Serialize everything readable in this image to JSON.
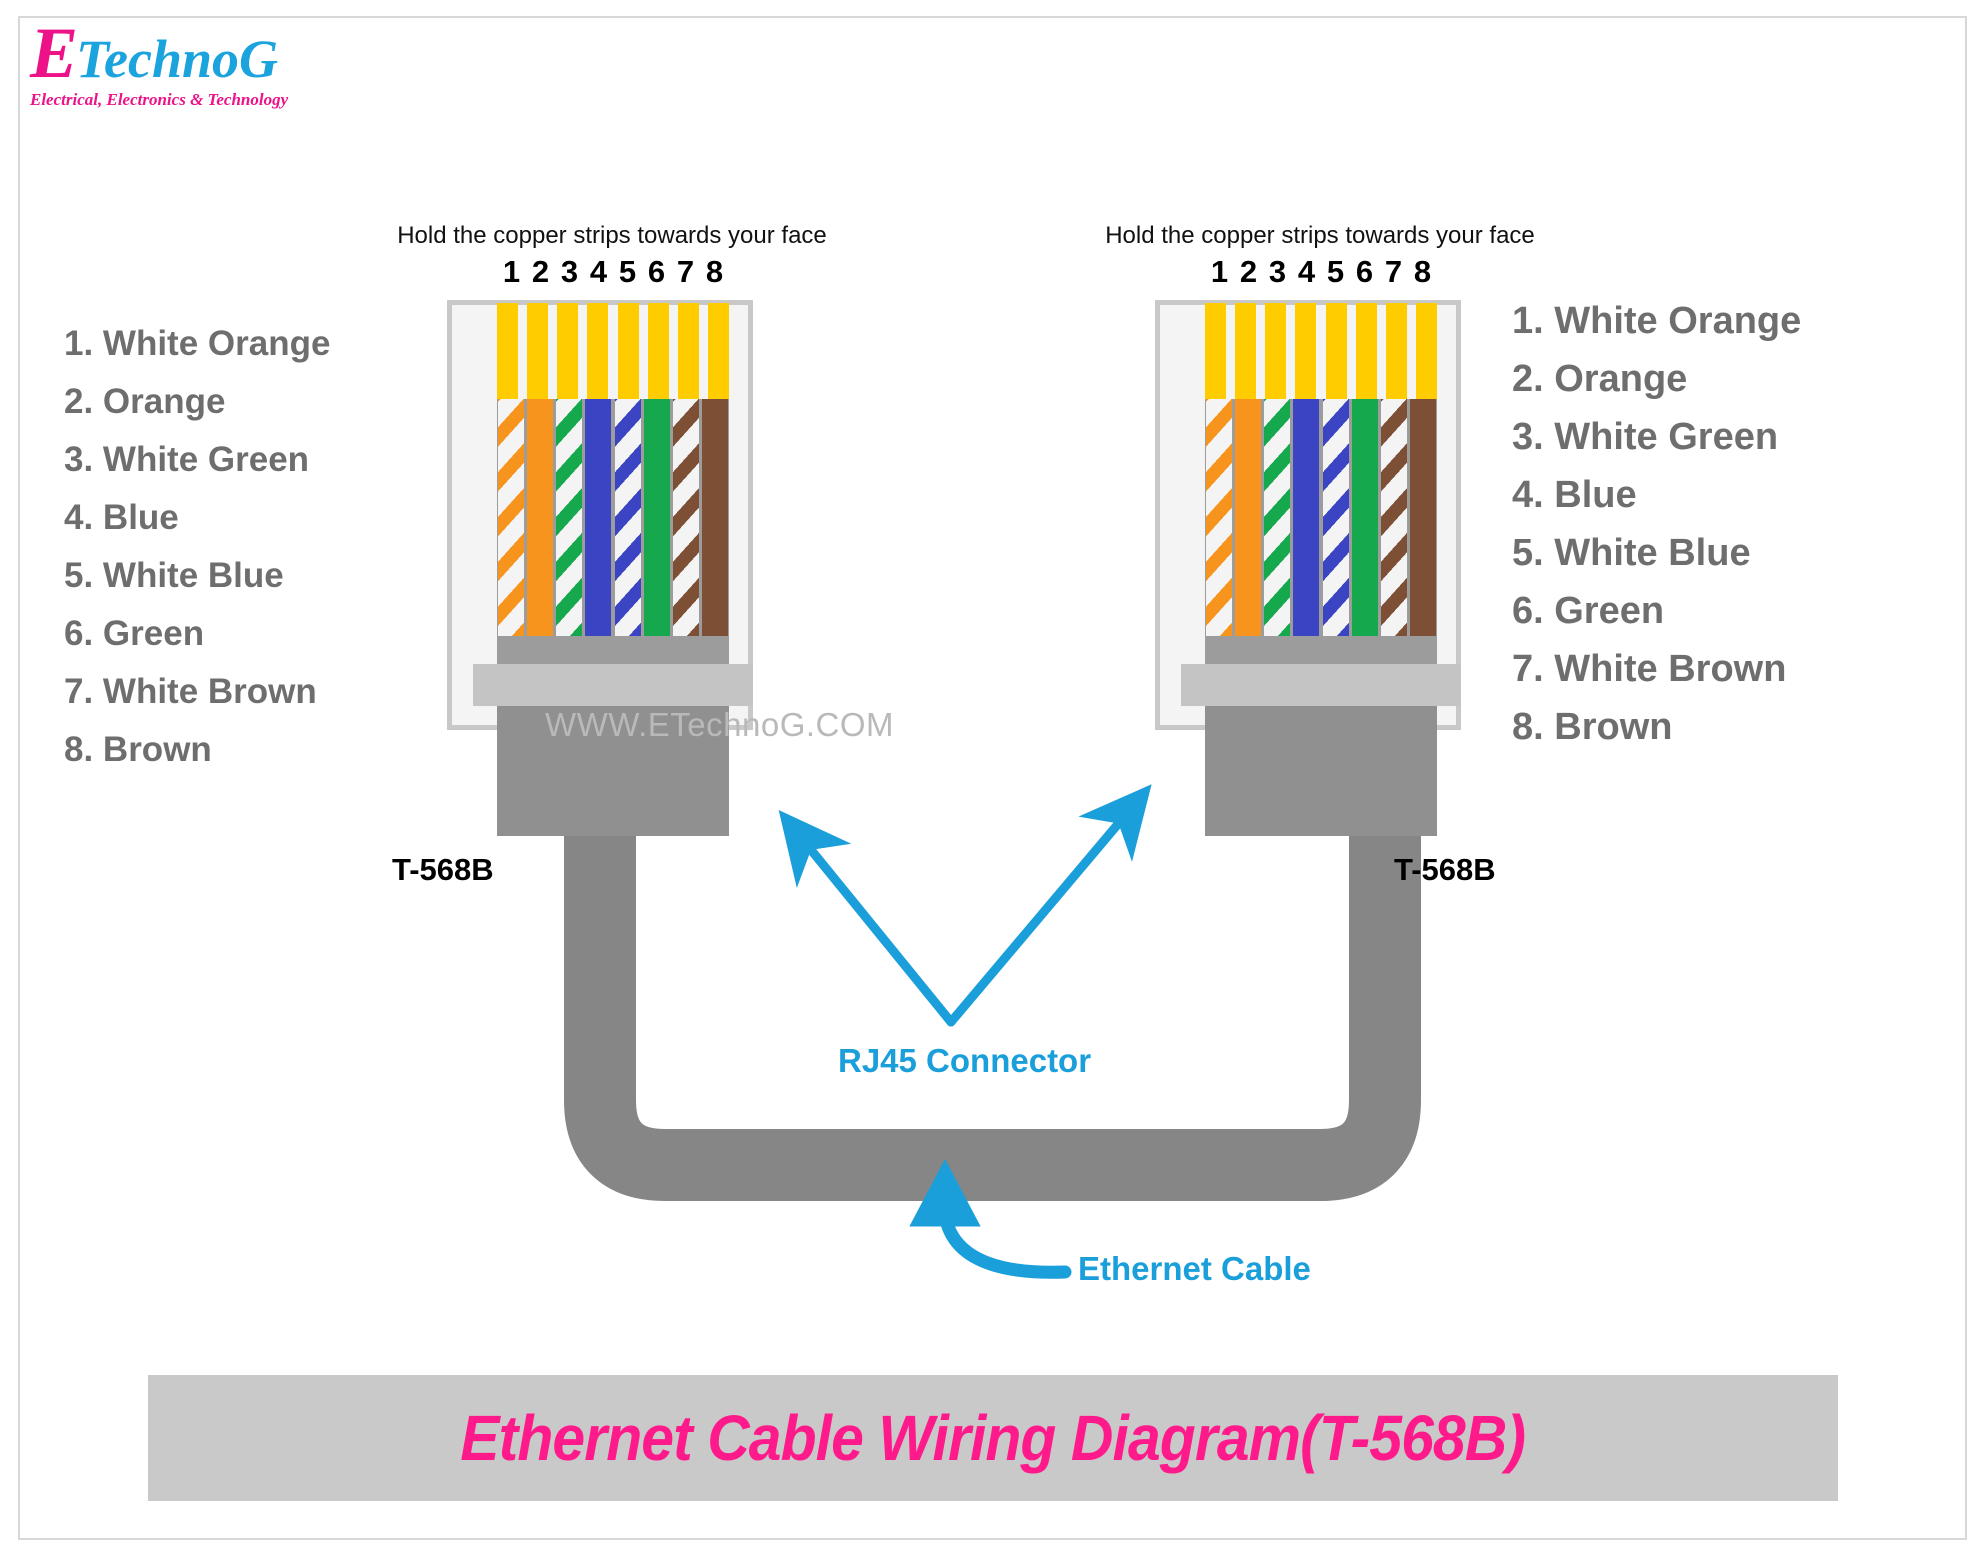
{
  "brand": {
    "logo_initial": "E",
    "logo_rest": "TechnoG",
    "tagline": "Electrical, Electronics & Technology"
  },
  "watermark": "WWW.ETechnoG.COM",
  "title": {
    "text": "Ethernet Cable Wiring Diagram(T-568B)",
    "bar_color": "#c9c9c9",
    "text_color": "#ff1a8c"
  },
  "instruction_text": "Hold the copper strips towards your face",
  "pin_numbers": [
    "1",
    "2",
    "3",
    "4",
    "5",
    "6",
    "7",
    "8"
  ],
  "standard_label": "T-568B",
  "annotations": {
    "rj45": "RJ45 Connector",
    "ethernet_cable": "Ethernet Cable",
    "arrow_color": "#1b9fda"
  },
  "pinout": {
    "standard": "T-568B",
    "pins": [
      {
        "num": "1.",
        "name": "White Orange",
        "color": "#f7941d",
        "style": "striped"
      },
      {
        "num": "2.",
        "name": "Orange",
        "color": "#f7941d",
        "style": "solid"
      },
      {
        "num": "3.",
        "name": "White Green",
        "color": "#15a84c",
        "style": "striped"
      },
      {
        "num": "4.",
        "name": "Blue",
        "color": "#3b45c4",
        "style": "solid"
      },
      {
        "num": "5.",
        "name": "White Blue",
        "color": "#3b45c4",
        "style": "striped"
      },
      {
        "num": "6.",
        "name": "Green",
        "color": "#15a84c",
        "style": "solid"
      },
      {
        "num": "7.",
        "name": "White Brown",
        "color": "#7d5036",
        "style": "striped"
      },
      {
        "num": "8.",
        "name": "Brown",
        "color": "#7d5036",
        "style": "solid"
      }
    ]
  },
  "left_list": {
    "rows": [
      "1. White Orange",
      "2. Orange",
      "3. White Green",
      "4. Blue",
      "5. White Blue",
      "6. Green",
      "7. White Brown",
      "8. Brown"
    ]
  },
  "right_list": {
    "rows": [
      "1. White Orange",
      "2. Orange",
      "3. White Green",
      "4. Blue",
      "5. White Blue",
      "6. Green",
      "7. White Brown",
      "8. Brown"
    ]
  },
  "colors": {
    "contact_gold": "#ffcc00",
    "cable_gray": "#868686",
    "plug_body_gray": "#909090",
    "plug_outline_gray": "#c8c8c8",
    "text_gray": "#6e6e6e",
    "brand_pink": "#ee1289",
    "brand_cyan": "#1aa3dd"
  }
}
